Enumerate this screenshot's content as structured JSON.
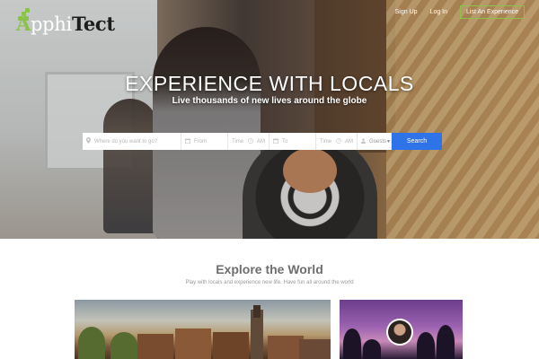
{
  "header": {
    "logo": {
      "part_a": "A",
      "part_b": "pphi",
      "part_c": "Tect"
    },
    "nav": [
      {
        "label": "Sign Up"
      },
      {
        "label": "Log In"
      }
    ],
    "cta_label": "List An Experience"
  },
  "hero": {
    "title": "EXPERIENCE WITH LOCALS",
    "subtitle": "Live thousands of new lives around the globe"
  },
  "search": {
    "where_placeholder": "Where do you want to go?",
    "from_label": "From",
    "from_time": "Time",
    "from_ampm": "AM",
    "to_label": "To",
    "to_time": "Time",
    "to_ampm": "AM",
    "guests_label": "Guests",
    "button_label": "Search",
    "icons": [
      "location-pin-icon",
      "calendar-icon",
      "clock-icon",
      "person-icon"
    ]
  },
  "explore": {
    "title": "Explore the World",
    "subtitle": "Play with locals and experience new life. Have fun all around the world"
  },
  "colors": {
    "brand_green": "#8bc34a",
    "search_blue": "#2f73e8"
  }
}
